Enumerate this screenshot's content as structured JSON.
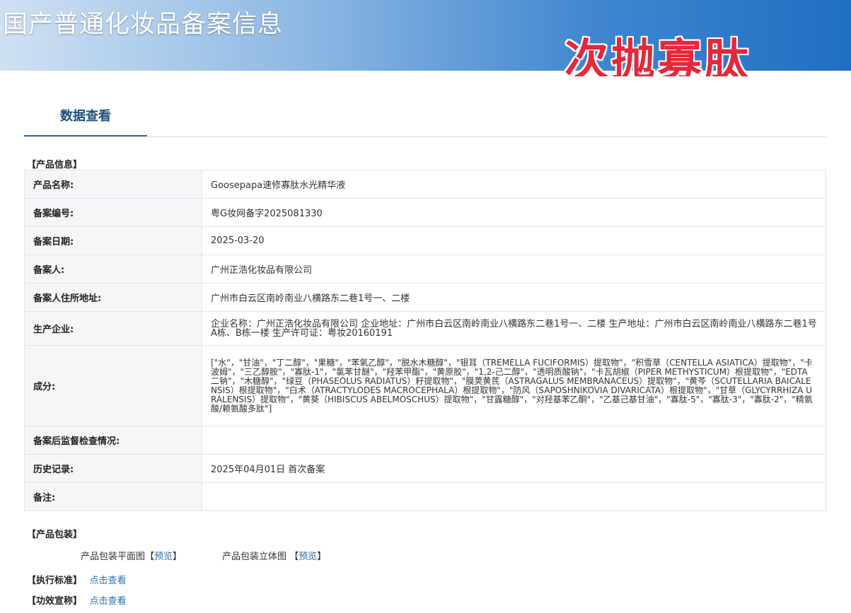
{
  "banner": {
    "title": "国产普通化妆品备案信息",
    "overlay_text": "次抛寡肽"
  },
  "tab": {
    "label": "数据查看"
  },
  "product_info": {
    "section_title": "【产品信息】",
    "rows": [
      {
        "key": "产品名称:",
        "value": "Goosepapa速修寡肽水光精华液"
      },
      {
        "key": "备案编号:",
        "value": "粤G妆网备字2025081330"
      },
      {
        "key": "备案日期:",
        "value": "2025-03-20"
      },
      {
        "key": "备案人:",
        "value": "广州正浩化妆品有限公司"
      },
      {
        "key": "备案人住所地址:",
        "value": "广州市白云区南岭南业八横路东二巷1号一、二楼"
      },
      {
        "key": "生产企业:",
        "value": "企业名称：广州正浩化妆品有限公司 企业地址：广州市白云区南岭南业八横路东二巷1号一、二楼 生产地址：广州市白云区南岭南业八横路东二巷1号A栋、B栋一楼 生产许可证：粤妆20160191"
      },
      {
        "key": "成分:",
        "value": "[\"水\"，\"甘油\"，\"丁二醇\"，\"果糖\"，\"苯氧乙醇\"，\"脱水木糖醇\"，\"银耳（TREMELLA FUCIFORMIS）提取物\"，\"积雪草（CENTELLA ASIATICA）提取物\"，\"卡波姆\"，\"三乙醇胺\"，\"寡肽-1\"，\"氯苯甘醚\"，\"羟苯甲酯\"，\"黄原胶\"，\"1,2-己二醇\"，\"透明质酸钠\"，\"卡瓦胡椒（PIPER METHYSTICUM）根提取物\"，\"EDTA 二钠\"，\"木糖醇\"，\"绿豆（PHASEOLUS RADIATUS）籽提取物\"，\"膜荚黄芪（ASTRAGALUS MEMBRANACEUS）提取物\"，\"黄芩（SCUTELLARIA BAICALENSIS）根提取物\"，\"白术（ATRACTYLODES MACROCEPHALA）根提取物\"，\"防风（SAPOSHNIKOVIA DIVARICATA）根提取物\"，\"甘草（GLYCYRRHIZA URALENSIS）提取物\"，\"黄葵（HIBISCUS ABELMOSCHUS）提取物\"，\"甘露糖醇\"，\"对羟基苯乙酮\"，\"乙基己基甘油\"，\"寡肽-5\"，\"寡肽-3\"，\"寡肽-2\"，\"精氨酸/赖氨酸多肽\"]"
      },
      {
        "key": "备案后监督检查情况:",
        "value": ""
      },
      {
        "key": "历史记录:",
        "value": "2025年04月01日 首次备案"
      },
      {
        "key": "备注:",
        "value": ""
      }
    ]
  },
  "packaging": {
    "section_title": "【产品包装】",
    "flat_label": "产品包装平面图",
    "flat_link": "预览",
    "solid_label": "产品包装立体图",
    "solid_link": "预览"
  },
  "standard": {
    "label": "【执行标准】",
    "link": "点击查看"
  },
  "efficacy": {
    "label": "【功效宣称】",
    "link": "点击查看"
  }
}
